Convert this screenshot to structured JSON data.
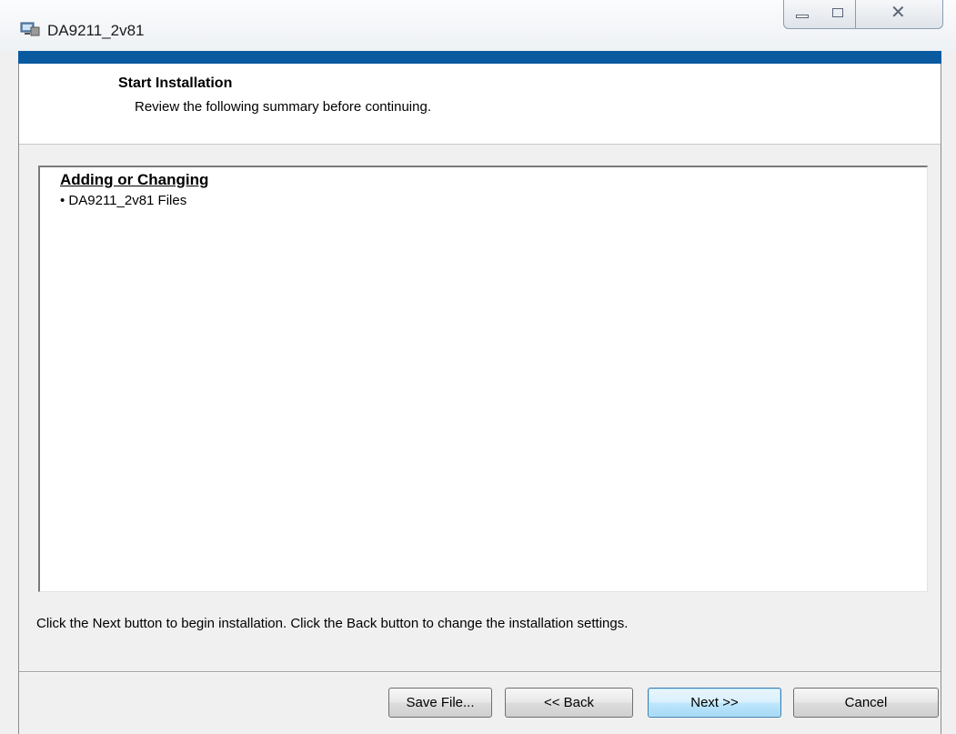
{
  "window": {
    "title": "DA9211_2v81",
    "icon": "installer-icon",
    "controls": {
      "minimize": "minimize-icon",
      "maximize": "maximize-icon",
      "close": "close-icon"
    }
  },
  "header": {
    "title": "Start Installation",
    "subtitle": "Review the following summary before continuing."
  },
  "summary": {
    "heading": "Adding or Changing",
    "items": [
      "• DA9211_2v81 Files"
    ]
  },
  "instructions": "Click the Next button to begin installation.  Click the Back button to change the installation settings.",
  "buttons": {
    "save": "Save File...",
    "back": "<< Back",
    "next": "Next >>",
    "cancel": "Cancel"
  },
  "colors": {
    "accent_strip": "#0a5aa0",
    "default_button_border": "#3c7fb1"
  }
}
